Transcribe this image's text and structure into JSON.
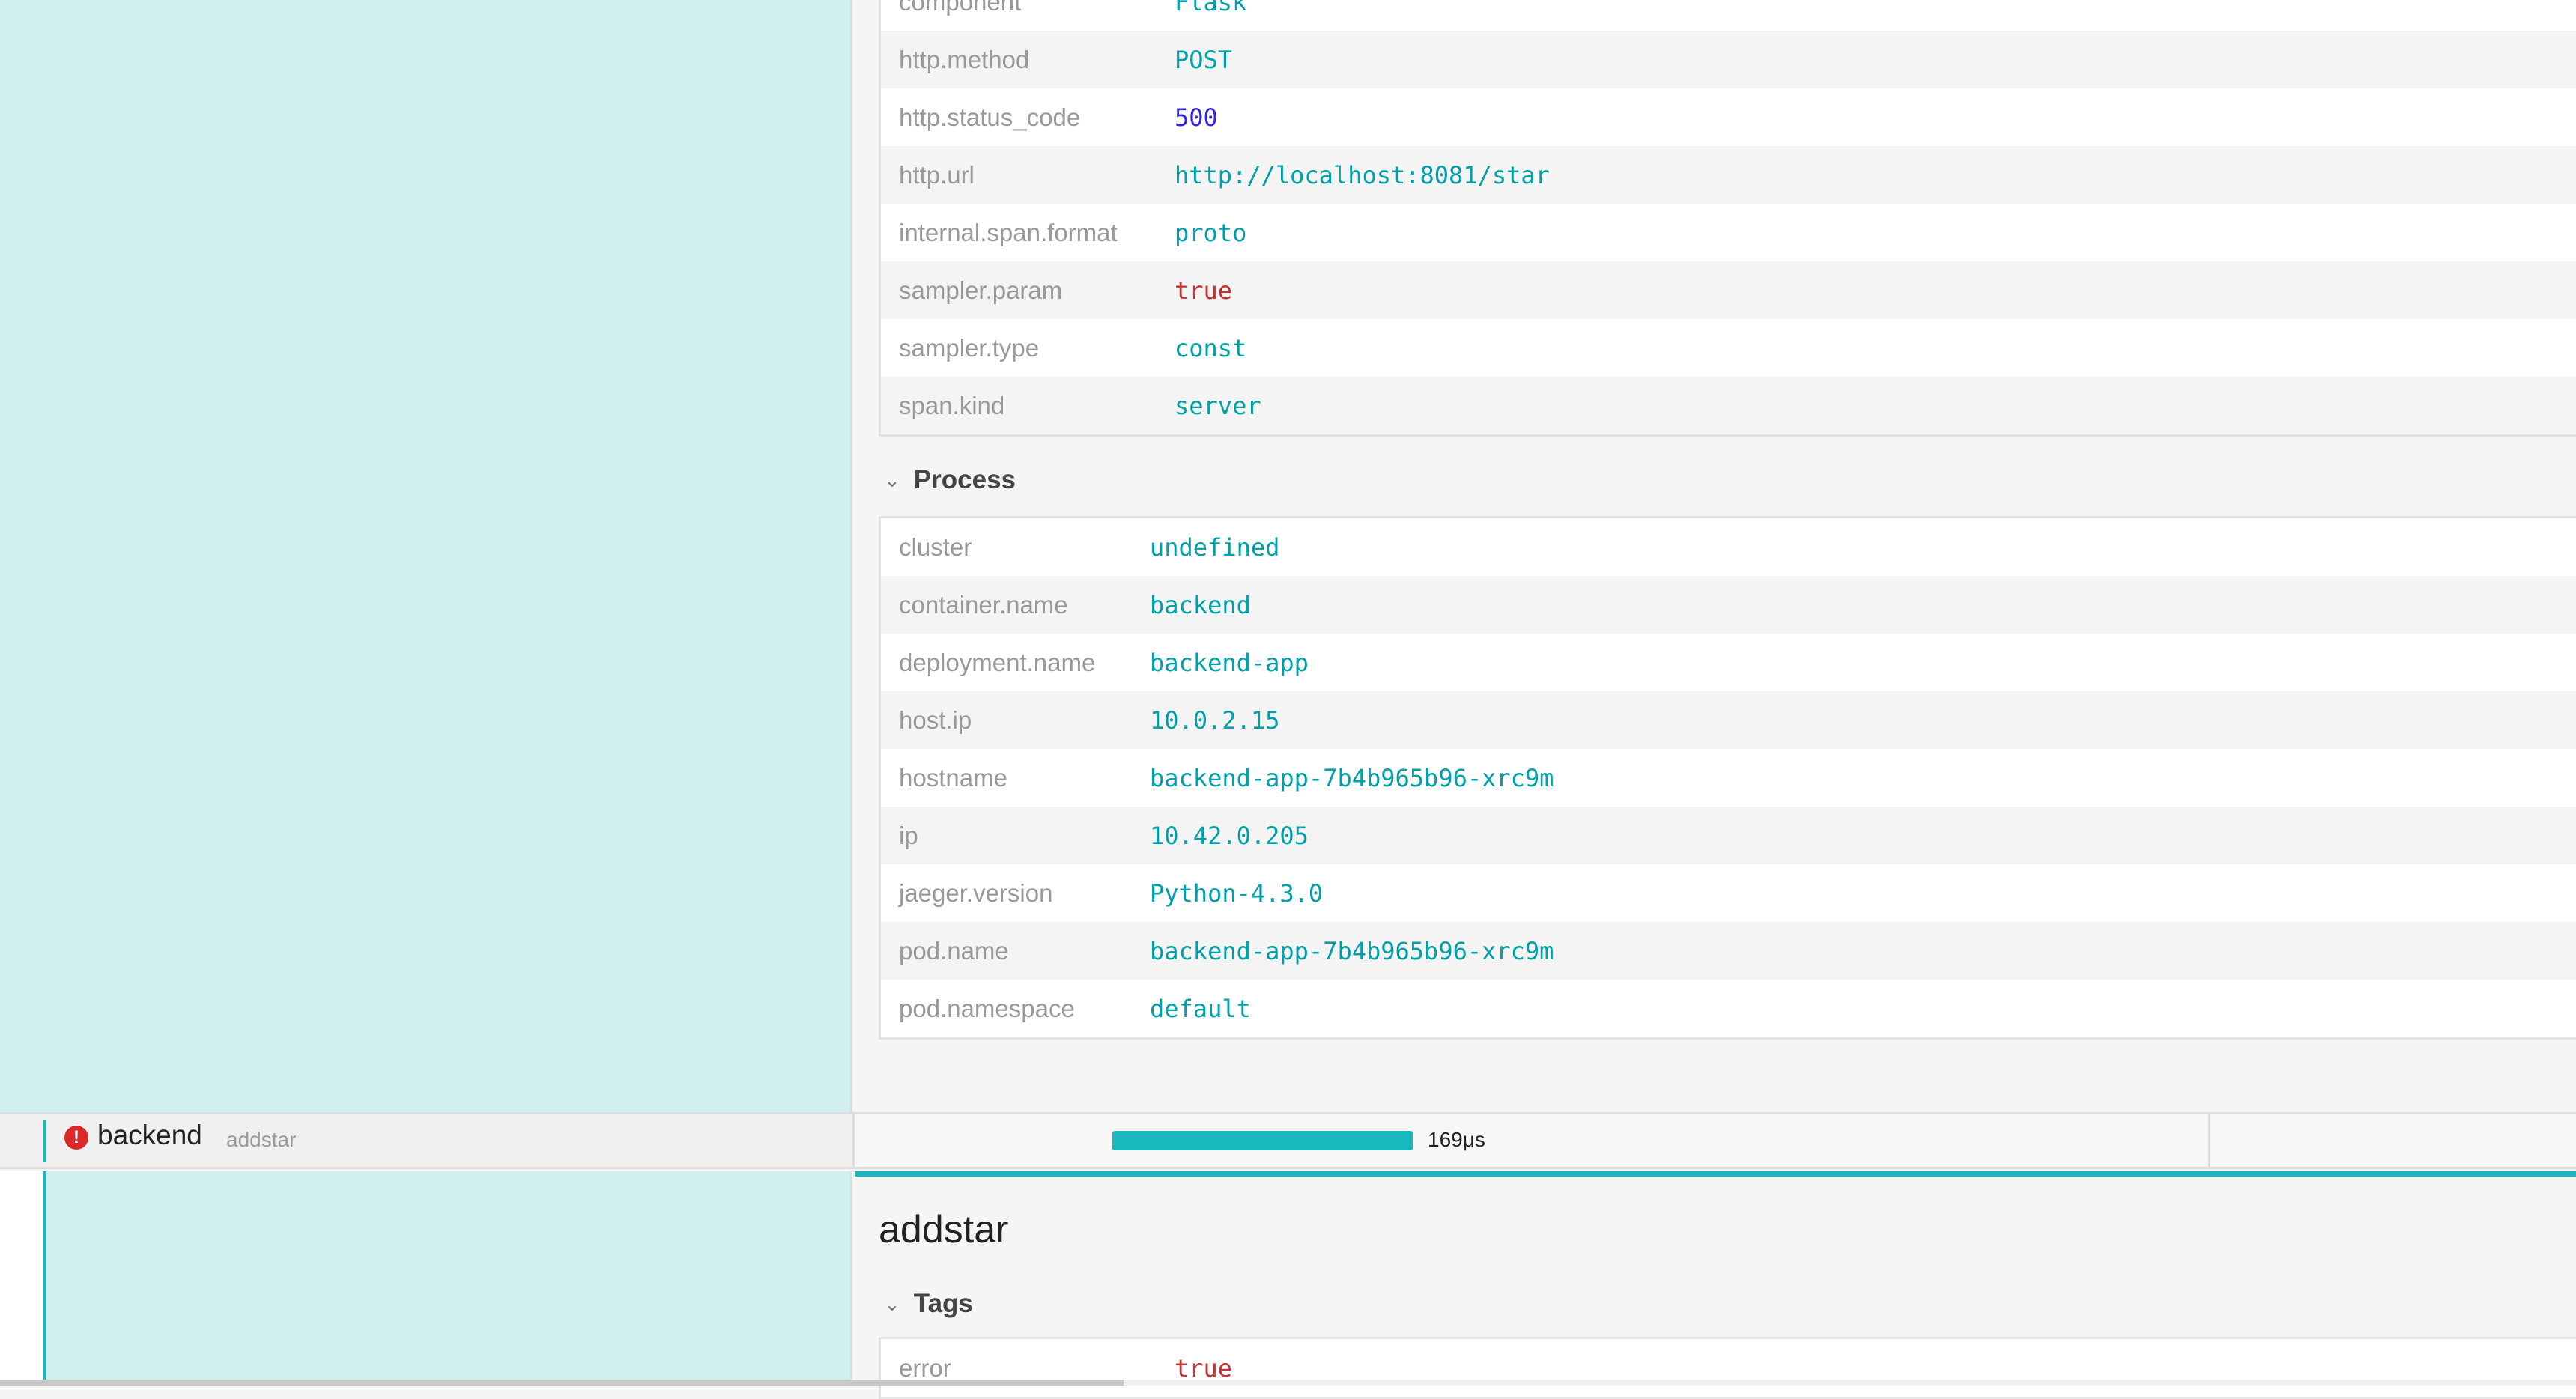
{
  "tags": [
    {
      "key": "component",
      "value": "Flask",
      "color": "#00a0a8"
    },
    {
      "key": "http.method",
      "value": "POST",
      "color": "#00a0a8"
    },
    {
      "key": "http.status_code",
      "value": "500",
      "color": "#3322ee"
    },
    {
      "key": "http.url",
      "value": "http://localhost:8081/star",
      "color": "#00a0a8"
    },
    {
      "key": "internal.span.format",
      "value": "proto",
      "color": "#00a0a8"
    },
    {
      "key": "sampler.param",
      "value": "true",
      "color": "#c83232"
    },
    {
      "key": "sampler.type",
      "value": "const",
      "color": "#00a0a8"
    },
    {
      "key": "span.kind",
      "value": "server",
      "color": "#00a0a8"
    }
  ],
  "process_label": "Process",
  "process": [
    {
      "key": "cluster",
      "value": "undefined"
    },
    {
      "key": "container.name",
      "value": "backend"
    },
    {
      "key": "deployment.name",
      "value": "backend-app"
    },
    {
      "key": "host.ip",
      "value": "10.0.2.15"
    },
    {
      "key": "hostname",
      "value": "backend-app-7b4b965b96-xrc9m"
    },
    {
      "key": "ip",
      "value": "10.42.0.205"
    },
    {
      "key": "jaeger.version",
      "value": "Python-4.3.0"
    },
    {
      "key": "pod.name",
      "value": "backend-app-7b4b965b96-xrc9m"
    },
    {
      "key": "pod.namespace",
      "value": "default"
    }
  ],
  "span": {
    "service": "backend",
    "operation": "addstar",
    "duration": "169μs",
    "error_icon": "exclamation-circle-icon",
    "bar_color": "#17b8be"
  },
  "detail": {
    "title": "addstar",
    "tags_label": "Tags",
    "tags": [
      {
        "key": "error",
        "value": "true",
        "color": "#c83232"
      }
    ]
  }
}
